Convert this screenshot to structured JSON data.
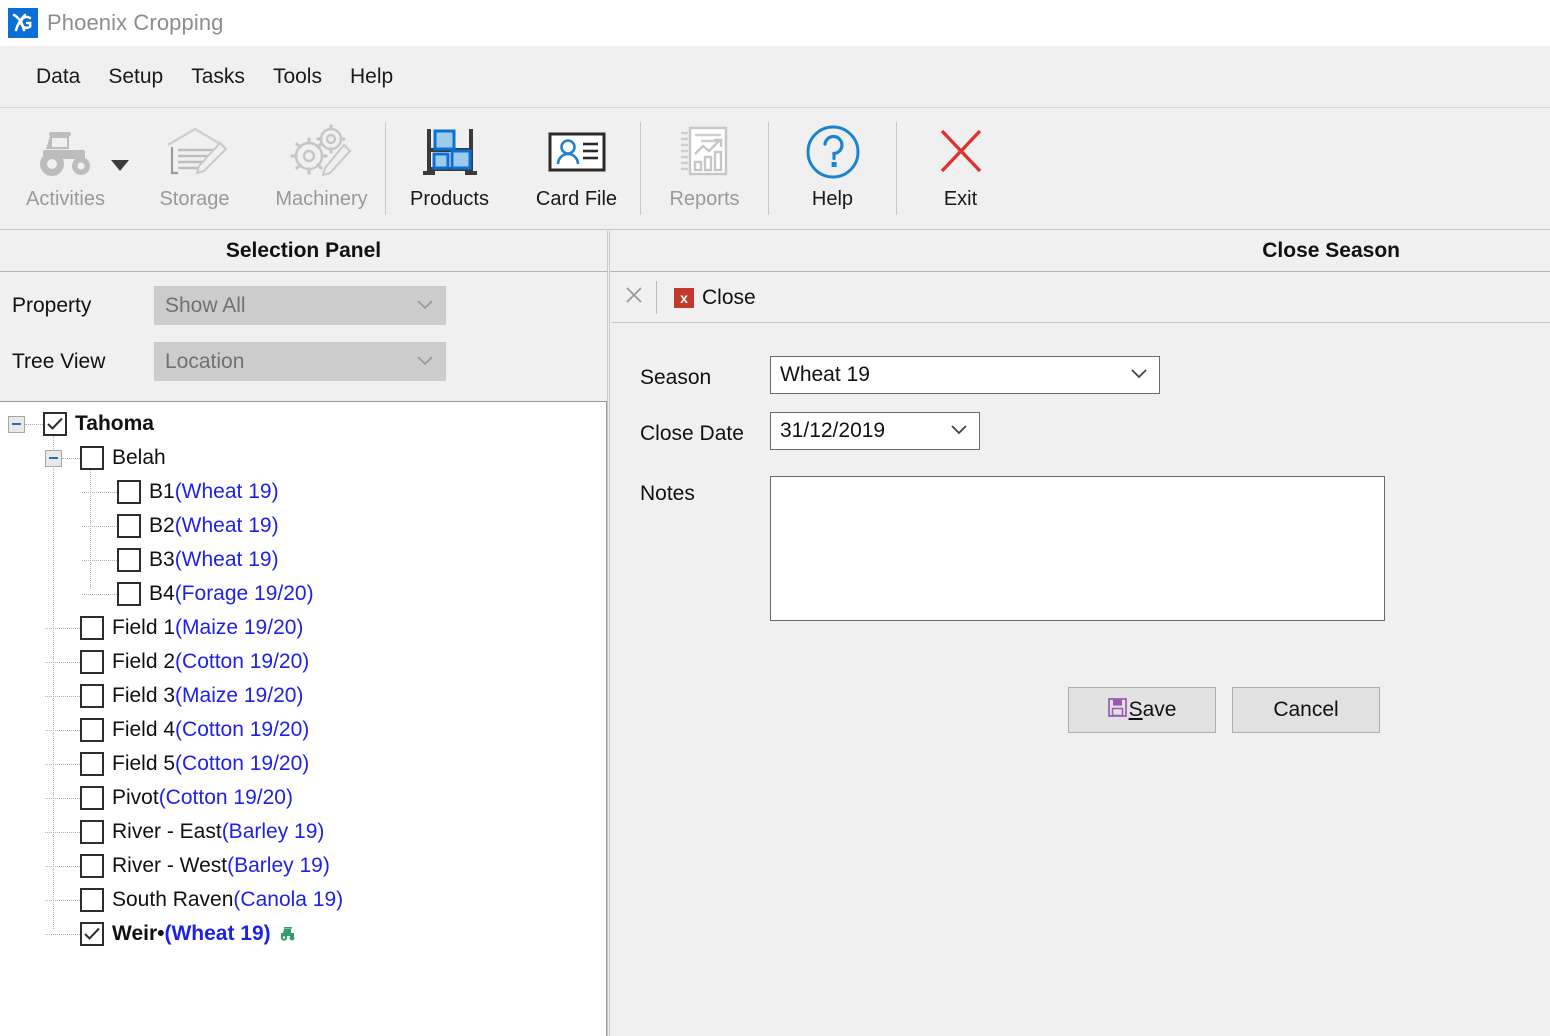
{
  "app": {
    "title": "Phoenix Cropping",
    "logo_icon": "phoenix-logo-icon"
  },
  "menu": {
    "items": [
      {
        "label": "Data"
      },
      {
        "label": "Setup"
      },
      {
        "label": "Tasks"
      },
      {
        "label": "Tools"
      },
      {
        "label": "Help"
      }
    ]
  },
  "toolbar": {
    "buttons": [
      {
        "label": "Activities",
        "icon": "tractor-icon",
        "disabled": true,
        "has_dropdown": true
      },
      {
        "label": "Storage",
        "icon": "storage-shed-icon",
        "disabled": true,
        "has_dropdown": false
      },
      {
        "label": "Machinery",
        "icon": "gears-pencil-icon",
        "disabled": true,
        "has_dropdown": false
      },
      {
        "label": "Products",
        "icon": "products-shelf-icon",
        "disabled": false,
        "has_dropdown": false
      },
      {
        "label": "Card File",
        "icon": "card-file-icon",
        "disabled": false,
        "has_dropdown": false
      },
      {
        "label": "Reports",
        "icon": "reports-chart-icon",
        "disabled": true,
        "has_dropdown": false
      },
      {
        "label": "Help",
        "icon": "help-question-icon",
        "disabled": false,
        "has_dropdown": false
      },
      {
        "label": "Exit",
        "icon": "exit-cross-icon",
        "disabled": false,
        "has_dropdown": false
      }
    ]
  },
  "selection_panel": {
    "title": "Selection Panel",
    "property_label": "Property",
    "property_value": "Show All",
    "tree_view_label": "Tree View",
    "tree_view_value": "Location",
    "tree": [
      {
        "name": "Tahoma",
        "crop": "",
        "depth": 0,
        "checked": true,
        "bold": true,
        "expander": "minus",
        "tractor": false
      },
      {
        "name": "Belah",
        "crop": "",
        "depth": 1,
        "checked": false,
        "bold": false,
        "expander": "minus",
        "tractor": false
      },
      {
        "name": "B1",
        "crop": "(Wheat 19)",
        "depth": 2,
        "checked": false,
        "bold": false,
        "expander": "none",
        "tractor": false
      },
      {
        "name": "B2",
        "crop": "(Wheat 19)",
        "depth": 2,
        "checked": false,
        "bold": false,
        "expander": "none",
        "tractor": false
      },
      {
        "name": "B3",
        "crop": "(Wheat 19)",
        "depth": 2,
        "checked": false,
        "bold": false,
        "expander": "none",
        "tractor": false
      },
      {
        "name": "B4",
        "crop": "(Forage 19/20)",
        "depth": 2,
        "checked": false,
        "bold": false,
        "expander": "none",
        "tractor": false
      },
      {
        "name": "Field 1",
        "crop": "(Maize 19/20)",
        "depth": 1,
        "checked": false,
        "bold": false,
        "expander": "none",
        "tractor": false
      },
      {
        "name": "Field 2",
        "crop": "(Cotton 19/20)",
        "depth": 1,
        "checked": false,
        "bold": false,
        "expander": "none",
        "tractor": false
      },
      {
        "name": "Field 3",
        "crop": "(Maize 19/20)",
        "depth": 1,
        "checked": false,
        "bold": false,
        "expander": "none",
        "tractor": false
      },
      {
        "name": "Field 4",
        "crop": "(Cotton 19/20)",
        "depth": 1,
        "checked": false,
        "bold": false,
        "expander": "none",
        "tractor": false
      },
      {
        "name": "Field 5",
        "crop": "(Cotton 19/20)",
        "depth": 1,
        "checked": false,
        "bold": false,
        "expander": "none",
        "tractor": false
      },
      {
        "name": "Pivot",
        "crop": "(Cotton 19/20)",
        "depth": 1,
        "checked": false,
        "bold": false,
        "expander": "none",
        "tractor": false
      },
      {
        "name": "River - East",
        "crop": "(Barley 19)",
        "depth": 1,
        "checked": false,
        "bold": false,
        "expander": "none",
        "tractor": false
      },
      {
        "name": "River - West",
        "crop": "(Barley 19)",
        "depth": 1,
        "checked": false,
        "bold": false,
        "expander": "none",
        "tractor": false
      },
      {
        "name": "South Raven",
        "crop": "(Canola 19)",
        "depth": 1,
        "checked": false,
        "bold": false,
        "expander": "none",
        "tractor": false
      },
      {
        "name": "Weir•",
        "crop": "(Wheat 19)",
        "depth": 1,
        "checked": true,
        "bold": true,
        "expander": "none",
        "tractor": true
      }
    ]
  },
  "right_panel": {
    "title": "Close Season",
    "toolbar": {
      "close_window_icon": "close-x-icon",
      "close_label": "Close",
      "close_icon": "red-x-badge-icon"
    },
    "form": {
      "season_label": "Season",
      "season_value": "Wheat 19",
      "close_date_label": "Close Date",
      "close_date_value": "31/12/2019",
      "notes_label": "Notes",
      "notes_value": ""
    },
    "actions": {
      "save_label": "Save",
      "save_accel": "S",
      "save_icon": "floppy-disk-icon",
      "cancel_label": "Cancel"
    }
  },
  "colors": {
    "accent": "#0b6fd6",
    "crop_text": "#1e22e8",
    "danger": "#c0392b",
    "exit_red": "#e03131",
    "save_icon": "#9b59b6",
    "tractor_green": "#2f9e6b"
  }
}
